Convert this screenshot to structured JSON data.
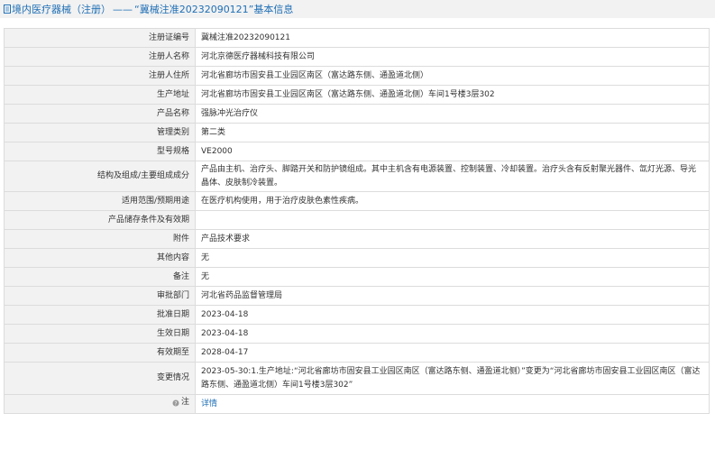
{
  "header": {
    "title_prefix": "境内医疗器械（注册）",
    "separator": "——",
    "title_suffix": "“冀械注准20232090121”基本信息",
    "accent": "#1f6fb5"
  },
  "rows": [
    {
      "label": "注册证编号",
      "value": "冀械注准20232090121"
    },
    {
      "label": "注册人名称",
      "value": "河北京德医疗器械科技有限公司"
    },
    {
      "label": "注册人住所",
      "value": "河北省廊坊市固安县工业园区南区（富达路东侧、通盈道北侧）"
    },
    {
      "label": "生产地址",
      "value": "河北省廊坊市固安县工业园区南区（富达路东侧、通盈道北侧）车间1号楼3层302"
    },
    {
      "label": "产品名称",
      "value": "强脉冲光治疗仪"
    },
    {
      "label": "管理类别",
      "value": "第二类"
    },
    {
      "label": "型号规格",
      "value": "VE2000"
    },
    {
      "label": "结构及组成/主要组成成分",
      "value": "产品由主机、治疗头、脚踏开关和防护镜组成。其中主机含有电源装置、控制装置、冷却装置。治疗头含有反射聚光器件、氙灯光源、导光晶体、皮肤制冷装置。"
    },
    {
      "label": "适用范围/预期用途",
      "value": "在医疗机构使用，用于治疗皮肤色素性疾病。"
    },
    {
      "label": "产品储存条件及有效期",
      "value": ""
    },
    {
      "label": "附件",
      "value": "产品技术要求"
    },
    {
      "label": "其他内容",
      "value": "无"
    },
    {
      "label": "备注",
      "value": "无"
    },
    {
      "label": "审批部门",
      "value": "河北省药品监督管理局"
    },
    {
      "label": "批准日期",
      "value": "2023-04-18"
    },
    {
      "label": "生效日期",
      "value": "2023-04-18"
    },
    {
      "label": "有效期至",
      "value": "2028-04-17"
    },
    {
      "label": "变更情况",
      "value": "2023-05-30:1.生产地址:“河北省廊坊市固安县工业园区南区（富达路东侧、通盈道北侧）”变更为“河北省廊坊市固安县工业园区南区（富达路东侧、通盈道北侧）车间1号楼3层302”"
    }
  ],
  "note": {
    "label": "注",
    "link_text": "详情"
  }
}
